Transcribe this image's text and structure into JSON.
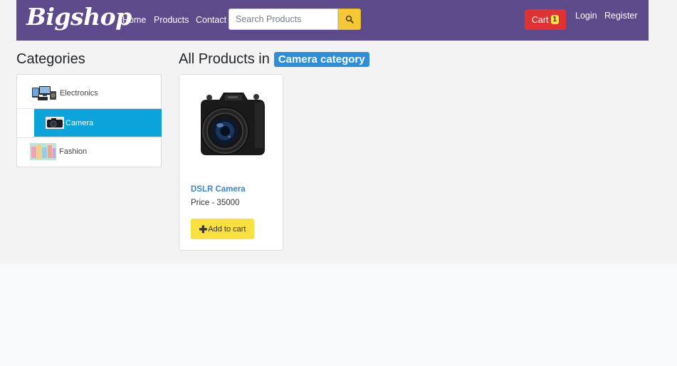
{
  "navbar": {
    "brand": "Bigshop",
    "links": {
      "home": "Home",
      "products": "Products",
      "contact": "Contact"
    },
    "search_placeholder": "Search Products",
    "search_icon": "search-icon",
    "cart_label": "Cart",
    "cart_count": "1",
    "login": "Login",
    "register": "Register"
  },
  "sidebar": {
    "heading": "Categories",
    "items": [
      {
        "label": "Electronics",
        "icon": "electronics-thumbnail"
      },
      {
        "label": "Camera",
        "icon": "camera-thumbnail",
        "active": true
      },
      {
        "label": "Fashion",
        "icon": "fashion-thumbnail"
      }
    ]
  },
  "main": {
    "heading": "All Products in",
    "category_badge": "Camera category",
    "products": [
      {
        "name": "DSLR Camera",
        "price": "Price - 35000",
        "add_label": "Add to cart",
        "image": "dslr-camera-image"
      }
    ]
  },
  "colors": {
    "navbar": "#5c4a8a",
    "cart": "#e03232",
    "active_category": "#0aa3da",
    "badge": "#2d8fd8",
    "add_button": "#f9e03e",
    "search_button": "#f4c935"
  }
}
